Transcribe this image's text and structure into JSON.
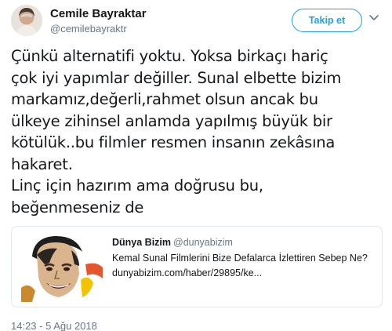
{
  "tweet": {
    "author": {
      "display_name": "Cemile Bayraktar",
      "handle": "@cemilebayraktr"
    },
    "follow_button_label": "Takip et",
    "text": "Çünkü alternatifi yoktu. Yoksa birkaçı hariç\nçok iyi yapımlar değiller. Sunal elbette bizim\nmarkamız,değerli,rahmet olsun ancak bu\nülkeye zihinsel anlamda yapılmış büyük bir\nkötülük..bu filmler resmen insanın zekâsına\nhakaret.\nLinç için hazırım ama doğrusu bu,\nbeğenmeseniz de",
    "quoted": {
      "display_name": "Dünya Bizim",
      "handle": "@dunyabizim",
      "title": "Kemal Sunal Filmlerini Bize Defalarca İzlettiren Sebep Ne?",
      "link": "dunyabizim.com/haber/29895/ke..."
    },
    "timestamp": "14:23 - 5 Ağu 2018"
  },
  "colors": {
    "accent": "#1da1f2",
    "text": "#14171a",
    "muted": "#657786",
    "border": "#e1e8ed"
  },
  "icons": {
    "menu": "chevron-down-icon"
  }
}
